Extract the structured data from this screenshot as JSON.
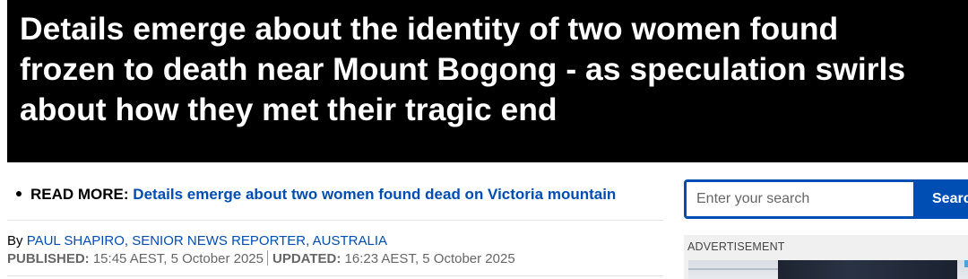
{
  "headline": {
    "lines": [
      "Details emerge about the identity of two women found",
      "frozen to death near Mount Bogong - as speculation swirls",
      "about how they met their tragic end"
    ]
  },
  "read_more": {
    "label": "READ MORE:",
    "link_text": "Details emerge about two women found dead on Victoria mountain"
  },
  "byline": {
    "prefix": "By",
    "author": "PAUL SHAPIRO, SENIOR NEWS REPORTER, AUSTRALIA",
    "published_label": "PUBLISHED:",
    "published_value": "15:45 AEST, 5 October 2025",
    "updated_label": "UPDATED:",
    "updated_value": "16:23 AEST, 5 October 2025"
  },
  "search": {
    "placeholder": "Enter your search",
    "button_label": "Search"
  },
  "advertisement": {
    "label": "ADVERTISEMENT"
  },
  "colors": {
    "headline_background": "#000000",
    "link_blue": "#004db3",
    "search_accent": "#004db3"
  }
}
